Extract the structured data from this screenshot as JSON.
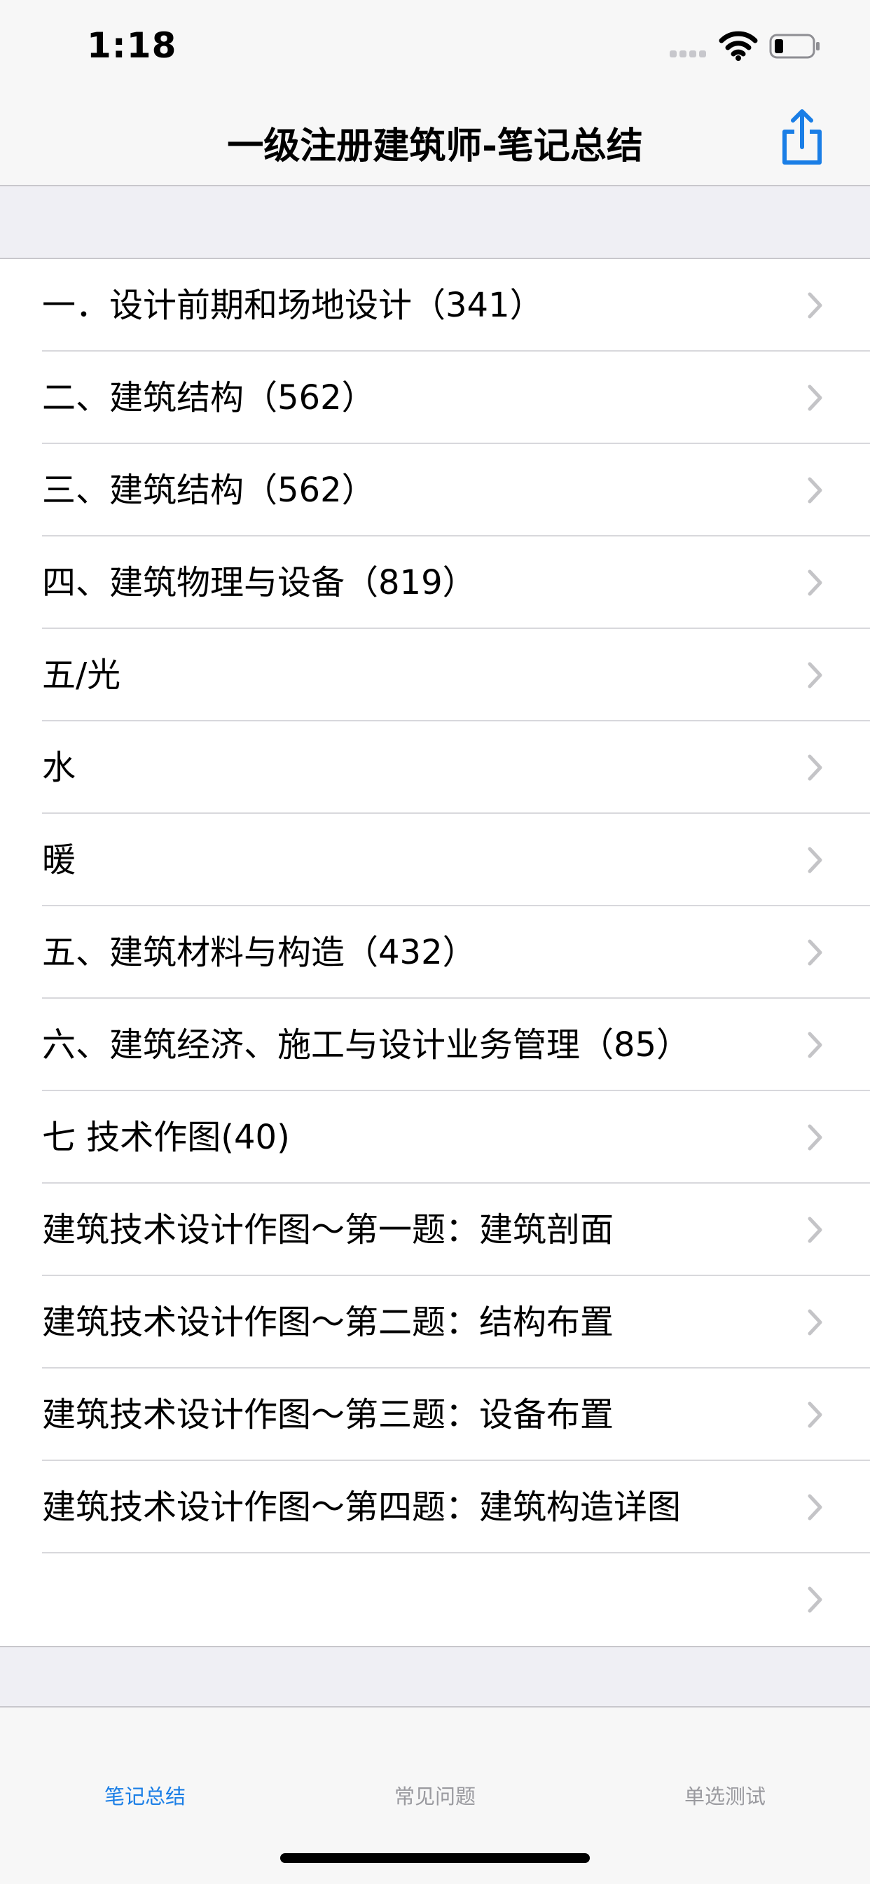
{
  "status_bar": {
    "time": "1:18"
  },
  "nav": {
    "title": "一级注册建筑师-笔记总结",
    "share_icon": "share-icon"
  },
  "list": {
    "items": [
      {
        "label": "一．设计前期和场地设计（341）"
      },
      {
        "label": "二、建筑结构（562）"
      },
      {
        "label": "三、建筑结构（562）"
      },
      {
        "label": "四、建筑物理与设备（819）"
      },
      {
        "label": "五/光"
      },
      {
        "label": "水"
      },
      {
        "label": "暖"
      },
      {
        "label": "五、建筑材料与构造（432）"
      },
      {
        "label": "六、建筑经济、施工与设计业务管理（85）"
      },
      {
        "label": "七 技术作图(40)"
      },
      {
        "label": "建筑技术设计作图～第一题：建筑剖面"
      },
      {
        "label": "建筑技术设计作图～第二题：结构布置"
      },
      {
        "label": "建筑技术设计作图～第三题：设备布置"
      },
      {
        "label": "建筑技术设计作图～第四题：建筑构造详图"
      },
      {
        "label": ""
      }
    ]
  },
  "tabs": [
    {
      "label": "笔记总结",
      "active": true
    },
    {
      "label": "常见问题",
      "active": false
    },
    {
      "label": "单选测试",
      "active": false
    }
  ],
  "colors": {
    "accent": "#1a7ee6",
    "inactive": "#9a9a9f",
    "chevron": "#c4c4c7",
    "background": "#efeff4"
  }
}
